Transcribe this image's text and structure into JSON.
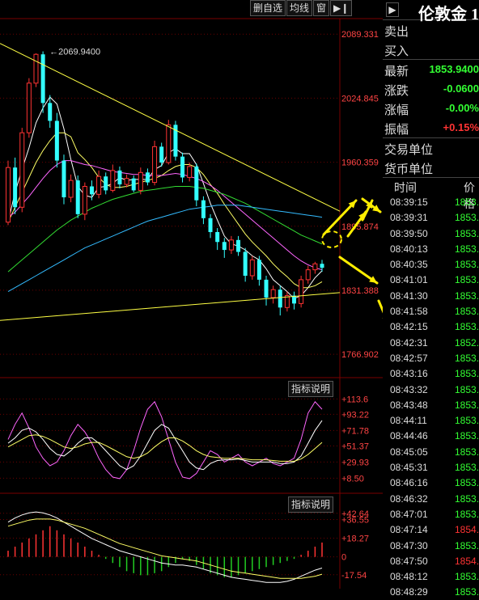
{
  "toolbar": {
    "buttons": [
      "删自选",
      "均线",
      "窗"
    ]
  },
  "panel": {
    "title": "伦敦金 1",
    "quote_rows": [
      {
        "label": "卖出",
        "value": "",
        "color": "#ffffff"
      },
      {
        "label": "买入",
        "value": "",
        "color": "#ffffff"
      },
      {
        "label": "最新",
        "value": "1853.9400",
        "color": "#33ff33"
      },
      {
        "label": "涨跌",
        "value": "-0.0600",
        "color": "#33ff33"
      },
      {
        "label": "涨幅",
        "value": "-0.00%",
        "color": "#33ff33"
      },
      {
        "label": "振幅",
        "value": "+0.15%",
        "color": "#ff3333"
      },
      {
        "label": "交易单位",
        "value": "",
        "color": "#ffffff"
      },
      {
        "label": "货币单位",
        "value": "",
        "color": "#ffffff"
      }
    ],
    "trade_header": {
      "time": "时间",
      "price": "价格"
    },
    "trades": [
      {
        "time": "08:39:15",
        "price": "1853.",
        "dir": "down"
      },
      {
        "time": "08:39:31",
        "price": "1853.",
        "dir": "down"
      },
      {
        "time": "08:39:50",
        "price": "1853.",
        "dir": "down"
      },
      {
        "time": "08:40:13",
        "price": "1853.",
        "dir": "down"
      },
      {
        "time": "08:40:35",
        "price": "1853.",
        "dir": "down"
      },
      {
        "time": "08:41:01",
        "price": "1853.",
        "dir": "down"
      },
      {
        "time": "08:41:30",
        "price": "1853.",
        "dir": "down"
      },
      {
        "time": "08:41:58",
        "price": "1853.",
        "dir": "down"
      },
      {
        "time": "08:42:15",
        "price": "1853.",
        "dir": "down"
      },
      {
        "time": "08:42:31",
        "price": "1852.",
        "dir": "down"
      },
      {
        "time": "08:42:57",
        "price": "1853.",
        "dir": "down"
      },
      {
        "time": "08:43:16",
        "price": "1853.",
        "dir": "down"
      },
      {
        "time": "08:43:32",
        "price": "1853.",
        "dir": "down"
      },
      {
        "time": "08:43:48",
        "price": "1853.",
        "dir": "down"
      },
      {
        "time": "08:44:11",
        "price": "1853.",
        "dir": "down"
      },
      {
        "time": "08:44:46",
        "price": "1853.",
        "dir": "down"
      },
      {
        "time": "08:45:05",
        "price": "1853.",
        "dir": "down"
      },
      {
        "time": "08:45:31",
        "price": "1853.",
        "dir": "down"
      },
      {
        "time": "08:46:16",
        "price": "1853.",
        "dir": "down"
      },
      {
        "time": "08:46:32",
        "price": "1853.",
        "dir": "down"
      },
      {
        "time": "08:47:01",
        "price": "1853.",
        "dir": "down"
      },
      {
        "time": "08:47:14",
        "price": "1854.",
        "dir": "up"
      },
      {
        "time": "08:47:30",
        "price": "1853.",
        "dir": "down"
      },
      {
        "time": "08:47:50",
        "price": "1854.",
        "dir": "up"
      },
      {
        "time": "08:48:12",
        "price": "1853.",
        "dir": "down"
      },
      {
        "time": "08:48:29",
        "price": "1853.",
        "dir": "down"
      }
    ]
  },
  "colors": {
    "up": "#ff3333",
    "down": "#33ffff",
    "grid": "#6b0000",
    "axis_text": "#ff4444",
    "trend": "#ffff44",
    "arrow": "#ffee00",
    "ma5": "#ffffff",
    "ma10": "#ffff66",
    "ma20": "#ff66ff",
    "ma40": "#33dd33",
    "ma60": "#33bbff",
    "macd_up": "#ff3333",
    "macd_down": "#22cc22"
  },
  "chart_data": [
    {
      "type": "candlestick",
      "y_ticks": [
        "2089.331",
        "2024.845",
        "1960.359",
        "1895.874",
        "1831.388",
        "1766.902"
      ],
      "ylim": [
        1745,
        2105
      ],
      "max_label": "2069.9400",
      "candles": [
        [
          1900,
          1955,
          1897,
          1962
        ],
        [
          1955,
          1915,
          1908,
          1965
        ],
        [
          1915,
          1990,
          1910,
          1995
        ],
        [
          1990,
          2040,
          1985,
          2045
        ],
        [
          2040,
          2069,
          2036,
          2070
        ],
        [
          2069,
          2020,
          2010,
          2072
        ],
        [
          2020,
          2002,
          1995,
          2028
        ],
        [
          2002,
          1962,
          1955,
          2010
        ],
        [
          1962,
          1925,
          1918,
          1968
        ],
        [
          1925,
          1942,
          1920,
          1948
        ],
        [
          1942,
          1908,
          1904,
          1947
        ],
        [
          1908,
          1936,
          1902,
          1940
        ],
        [
          1936,
          1928,
          1922,
          1942
        ],
        [
          1928,
          1946,
          1924,
          1952
        ],
        [
          1946,
          1932,
          1928,
          1950
        ],
        [
          1932,
          1952,
          1930,
          1958
        ],
        [
          1952,
          1938,
          1934,
          1956
        ],
        [
          1938,
          1944,
          1935,
          1948
        ],
        [
          1944,
          1932,
          1930,
          1947
        ],
        [
          1932,
          1950,
          1928,
          1955
        ],
        [
          1950,
          1940,
          1937,
          1954
        ],
        [
          1940,
          1976,
          1937,
          1982
        ],
        [
          1976,
          1960,
          1956,
          1980
        ],
        [
          1960,
          1998,
          1958,
          2003
        ],
        [
          1998,
          1966,
          1962,
          2002
        ],
        [
          1966,
          1945,
          1940,
          1970
        ],
        [
          1945,
          1956,
          1941,
          1960
        ],
        [
          1956,
          1922,
          1916,
          1959
        ],
        [
          1922,
          1904,
          1898,
          1926
        ],
        [
          1904,
          1890,
          1884,
          1908
        ],
        [
          1890,
          1880,
          1872,
          1894
        ],
        [
          1880,
          1872,
          1864,
          1884
        ],
        [
          1872,
          1882,
          1868,
          1886
        ],
        [
          1882,
          1870,
          1866,
          1886
        ],
        [
          1870,
          1846,
          1840,
          1874
        ],
        [
          1846,
          1862,
          1842,
          1866
        ],
        [
          1862,
          1842,
          1836,
          1866
        ],
        [
          1842,
          1824,
          1816,
          1846
        ],
        [
          1824,
          1832,
          1818,
          1836
        ],
        [
          1832,
          1814,
          1806,
          1836
        ],
        [
          1814,
          1826,
          1810,
          1830
        ],
        [
          1826,
          1818,
          1812,
          1830
        ],
        [
          1818,
          1842,
          1814,
          1846
        ],
        [
          1842,
          1852,
          1838,
          1856
        ],
        [
          1852,
          1858,
          1848,
          1860
        ],
        [
          1858,
          1854,
          1850,
          1862
        ]
      ],
      "ma": [
        {
          "name": "MA5",
          "values": [
            1900,
            1930,
            1953,
            1975,
            2000,
            2015,
            2026,
            2019,
            1994,
            1963,
            1936,
            1927,
            1925,
            1935,
            1936,
            1939,
            1945,
            1942,
            1943,
            1943,
            1943,
            1953,
            1957,
            1970,
            1974,
            1969,
            1969,
            1958,
            1939,
            1919,
            1902,
            1886,
            1878,
            1876,
            1872,
            1866,
            1862,
            1853,
            1842,
            1836,
            1830,
            1823,
            1826,
            1834,
            1844,
            1851
          ]
        },
        {
          "name": "MA10",
          "values": [
            1900,
            1915,
            1930,
            1945,
            1960,
            1972,
            1982,
            1990,
            1990,
            1986,
            1970,
            1963,
            1955,
            1945,
            1938,
            1935,
            1935,
            1936,
            1938,
            1940,
            1942,
            1944,
            1947,
            1952,
            1956,
            1958,
            1958,
            1955,
            1948,
            1938,
            1929,
            1918,
            1908,
            1898,
            1888,
            1880,
            1873,
            1866,
            1858,
            1851,
            1845,
            1838,
            1834,
            1834,
            1836,
            1840
          ]
        },
        {
          "name": "MA20",
          "values": [
            1905,
            1910,
            1918,
            1926,
            1935,
            1944,
            1952,
            1958,
            1962,
            1962,
            1960,
            1958,
            1957,
            1955,
            1953,
            1951,
            1950,
            1949,
            1948,
            1948,
            1947,
            1947,
            1947,
            1948,
            1949,
            1948,
            1946,
            1944,
            1941,
            1937,
            1932,
            1926,
            1920,
            1914,
            1908,
            1902,
            1896,
            1890,
            1884,
            1878,
            1872,
            1866,
            1861,
            1857,
            1854,
            1852
          ]
        },
        {
          "name": "MA40",
          "values": [
            1850,
            1856,
            1862,
            1868,
            1874,
            1880,
            1886,
            1892,
            1897,
            1902,
            1906,
            1910,
            1914,
            1917,
            1920,
            1923,
            1925,
            1927,
            1929,
            1931,
            1932,
            1933,
            1934,
            1935,
            1936,
            1936,
            1936,
            1935,
            1934,
            1932,
            1930,
            1928,
            1925,
            1922,
            1919,
            1915,
            1911,
            1907,
            1903,
            1899,
            1895,
            1891,
            1887,
            1884,
            1881,
            1878
          ]
        },
        {
          "name": "MA60",
          "values": [
            1830,
            1834,
            1838,
            1842,
            1846,
            1850,
            1854,
            1858,
            1862,
            1866,
            1870,
            1874,
            1877,
            1880,
            1883,
            1886,
            1889,
            1892,
            1895,
            1898,
            1901,
            1903,
            1905,
            1907,
            1909,
            1911,
            1913,
            1914,
            1915,
            1916,
            1917,
            1917,
            1917,
            1917,
            1916,
            1915,
            1914,
            1913,
            1912,
            1911,
            1910,
            1909,
            1908,
            1907,
            1906,
            1905
          ]
        }
      ]
    },
    {
      "type": "line",
      "title": "指标说明",
      "y_ticks": [
        "113.6",
        "93.22",
        "71.78",
        "51.37",
        "29.93",
        "8.50"
      ],
      "ylim": [
        -5,
        128
      ],
      "series": [
        {
          "values": [
            60,
            80,
            95,
            75,
            50,
            35,
            25,
            30,
            45,
            65,
            80,
            70,
            55,
            35,
            20,
            10,
            8,
            20,
            45,
            75,
            100,
            110,
            90,
            60,
            30,
            10,
            8,
            15,
            30,
            45,
            40,
            30,
            35,
            40,
            30,
            25,
            30,
            35,
            28,
            25,
            30,
            35,
            60,
            95,
            110,
            100
          ]
        },
        {
          "values": [
            55,
            62,
            72,
            75,
            70,
            60,
            48,
            40,
            38,
            45,
            55,
            62,
            62,
            55,
            45,
            35,
            25,
            20,
            25,
            38,
            55,
            72,
            80,
            75,
            60,
            45,
            30,
            22,
            20,
            28,
            32,
            33,
            33,
            34,
            32,
            30,
            30,
            30,
            30,
            28,
            28,
            30,
            38,
            55,
            72,
            85
          ]
        },
        {
          "values": [
            50,
            55,
            60,
            65,
            66,
            64,
            60,
            55,
            50,
            48,
            50,
            54,
            56,
            56,
            52,
            47,
            42,
            37,
            35,
            37,
            42,
            50,
            57,
            62,
            62,
            58,
            52,
            45,
            40,
            37,
            36,
            35,
            35,
            35,
            34,
            33,
            33,
            33,
            32,
            31,
            31,
            31,
            34,
            40,
            48,
            56
          ]
        }
      ]
    },
    {
      "type": "bar+line",
      "title": "指标说明",
      "y_ticks": [
        "42.64",
        "36.55",
        "18.27",
        "0",
        "-17.54"
      ],
      "ylim": [
        -28,
        48
      ],
      "histogram": [
        6,
        10,
        14,
        18,
        22,
        26,
        30,
        26,
        22,
        18,
        14,
        10,
        6,
        2,
        -2,
        -6,
        -10,
        -14,
        -16,
        -18,
        -18,
        -16,
        -14,
        -10,
        -6,
        -2,
        -4,
        -8,
        -12,
        -16,
        -18,
        -20,
        -20,
        -18,
        -16,
        -14,
        -12,
        -10,
        -8,
        -6,
        -4,
        -2,
        2,
        6,
        10,
        14
      ],
      "series": [
        {
          "values": [
            34,
            38,
            41,
            43,
            44,
            43,
            41,
            38,
            34,
            30,
            26,
            22,
            18,
            15,
            12,
            9,
            6,
            4,
            2,
            0,
            -2,
            -4,
            -6,
            -7,
            -8,
            -8,
            -9,
            -10,
            -12,
            -14,
            -16,
            -18,
            -20,
            -21,
            -22,
            -23,
            -24,
            -25,
            -25,
            -25,
            -24,
            -22,
            -19,
            -16,
            -13,
            -11
          ]
        },
        {
          "values": [
            30,
            32,
            34,
            36,
            37,
            37,
            37,
            36,
            34,
            32,
            30,
            28,
            25,
            22,
            19,
            16,
            13,
            11,
            9,
            7,
            5,
            3,
            1,
            0,
            -1,
            -2,
            -3,
            -4,
            -6,
            -8,
            -10,
            -12,
            -14,
            -15,
            -16,
            -17,
            -18,
            -19,
            -20,
            -21,
            -21,
            -21,
            -21,
            -20,
            -19,
            -17
          ]
        }
      ]
    }
  ]
}
